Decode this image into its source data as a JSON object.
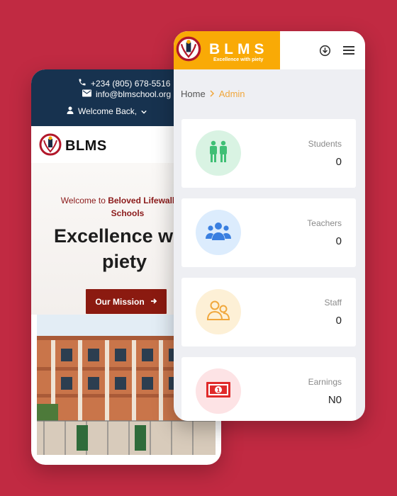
{
  "website": {
    "phone": "+234 (805) 678-5516",
    "email": "info@blmschool.org",
    "welcome_menu": "Welcome Back,",
    "brand_name": "BLMS",
    "hero": {
      "welcome_prefix": "Welcome to ",
      "welcome_school_line1": "Beloved Lifewalk Mo",
      "welcome_school_line2": "Schools",
      "title_line1": "Excellence w",
      "title_line2": "piety",
      "button_label": "Our Mission"
    }
  },
  "dashboard": {
    "brand_name": "BLMS",
    "tagline": "Excellence with piety",
    "breadcrumb": {
      "home": "Home",
      "current": "Admin"
    },
    "cards": [
      {
        "label": "Students",
        "value": "0",
        "icon": "students-icon",
        "color": "#d9f3e3",
        "icon_color": "#3fbf75"
      },
      {
        "label": "Teachers",
        "value": "0",
        "icon": "teachers-icon",
        "color": "#dcecfd",
        "icon_color": "#3a7fe0"
      },
      {
        "label": "Staff",
        "value": "0",
        "icon": "staff-icon",
        "color": "#fdf0d6",
        "icon_color": "#f0a73c"
      },
      {
        "label": "Earnings",
        "value": "N0",
        "icon": "money-icon",
        "color": "#fde3e5",
        "icon_color": "#e02a2a"
      }
    ]
  },
  "colors": {
    "background": "#c12a42",
    "topbar": "#17324f",
    "brand_orange": "#f9aa06",
    "mission_button": "#8b1a10"
  }
}
